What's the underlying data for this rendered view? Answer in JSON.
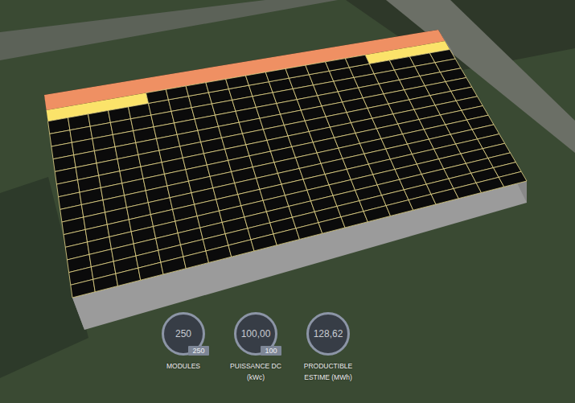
{
  "gauges": [
    {
      "value": "250",
      "badge": "250",
      "label": [
        "MODULES"
      ]
    },
    {
      "value": "100,00",
      "badge": "100",
      "label": [
        "PUISSANCE DC",
        "(kWc)"
      ]
    },
    {
      "value": "128,62",
      "label": [
        "PRODUCTIBLE",
        "ESTIME (MWh)"
      ]
    }
  ]
}
